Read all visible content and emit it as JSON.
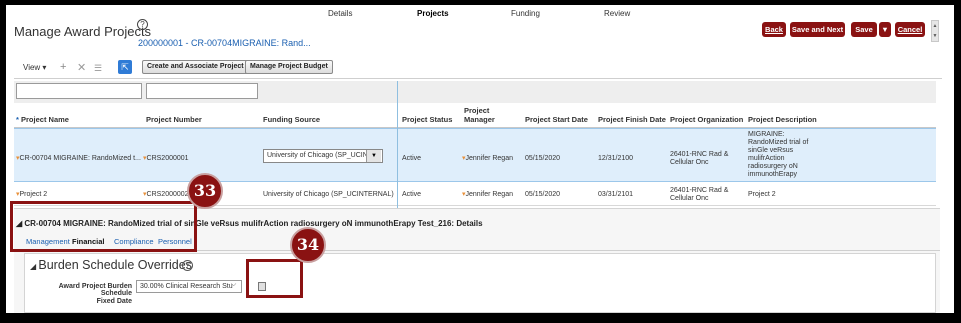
{
  "train": {
    "details": "Details",
    "projects": "Projects",
    "funding": "Funding",
    "review": "Review"
  },
  "header": {
    "title": "Manage Award Projects",
    "subtitle": "200000001 - CR-00704MIGRAINE: Rand...",
    "buttons": {
      "back": "Back",
      "save_next": "Save and Next",
      "save": "Save",
      "save_menu": "▼",
      "cancel": "Cancel"
    }
  },
  "toolbar": {
    "view_label": "View ▾",
    "create_btn": "Create and Associate Project",
    "budget_btn": "Manage Project Budget"
  },
  "columns": {
    "project_name": "Project Name",
    "project_number": "Project Number",
    "funding_source": "Funding Source",
    "project_status": "Project Status",
    "project_manager": "Project Manager",
    "start_date": "Project Start Date",
    "finish_date": "Project Finish Date",
    "organization": "Project Organization",
    "description": "Project Description"
  },
  "rows": [
    {
      "name": "CR-00704 MIGRAINE: RandoMized t...",
      "number": "CRS2000001",
      "funding": "University of Chicago (SP_UCINT",
      "status": "Active",
      "manager": "Jennifer Regan",
      "start": "05/15/2020",
      "finish": "12/31/2100",
      "org": "26401-RNC Rad & Cellular Onc",
      "description": "MIGRAINE: RandoMized trial of sinGle veRsus mulifrAction radiosurgery oN immunothErapy"
    },
    {
      "name": "Project 2",
      "number": "CRS2000002",
      "funding": "University of Chicago (SP_UCINTERNAL)",
      "status": "Active",
      "manager": "Jennifer Regan",
      "start": "05/15/2020",
      "finish": "03/31/2101",
      "org": "26401-RNC Rad & Cellular Onc",
      "description": "Project 2"
    }
  ],
  "details": {
    "title": "CR-00704 MIGRAINE: RandoMized trial of sinGle veRsus mulifrAction radiosurgery oN immunothErapy Test_216: Details",
    "tabs": [
      "Management",
      "Financial",
      "Compliance",
      "Personnel"
    ],
    "active_tab": "Financial",
    "section_title": "Burden Schedule Overrides",
    "burden_label": "Award Project Burden Schedule",
    "burden_value": "30.00% Clinical Research Stu",
    "fixed_date_label": "Fixed Date"
  },
  "callouts": {
    "a": "33",
    "b": "34"
  },
  "colors": {
    "brand_button": "#8a1212",
    "link": "#1a5fb0",
    "selected_row": "#dfeefb"
  }
}
